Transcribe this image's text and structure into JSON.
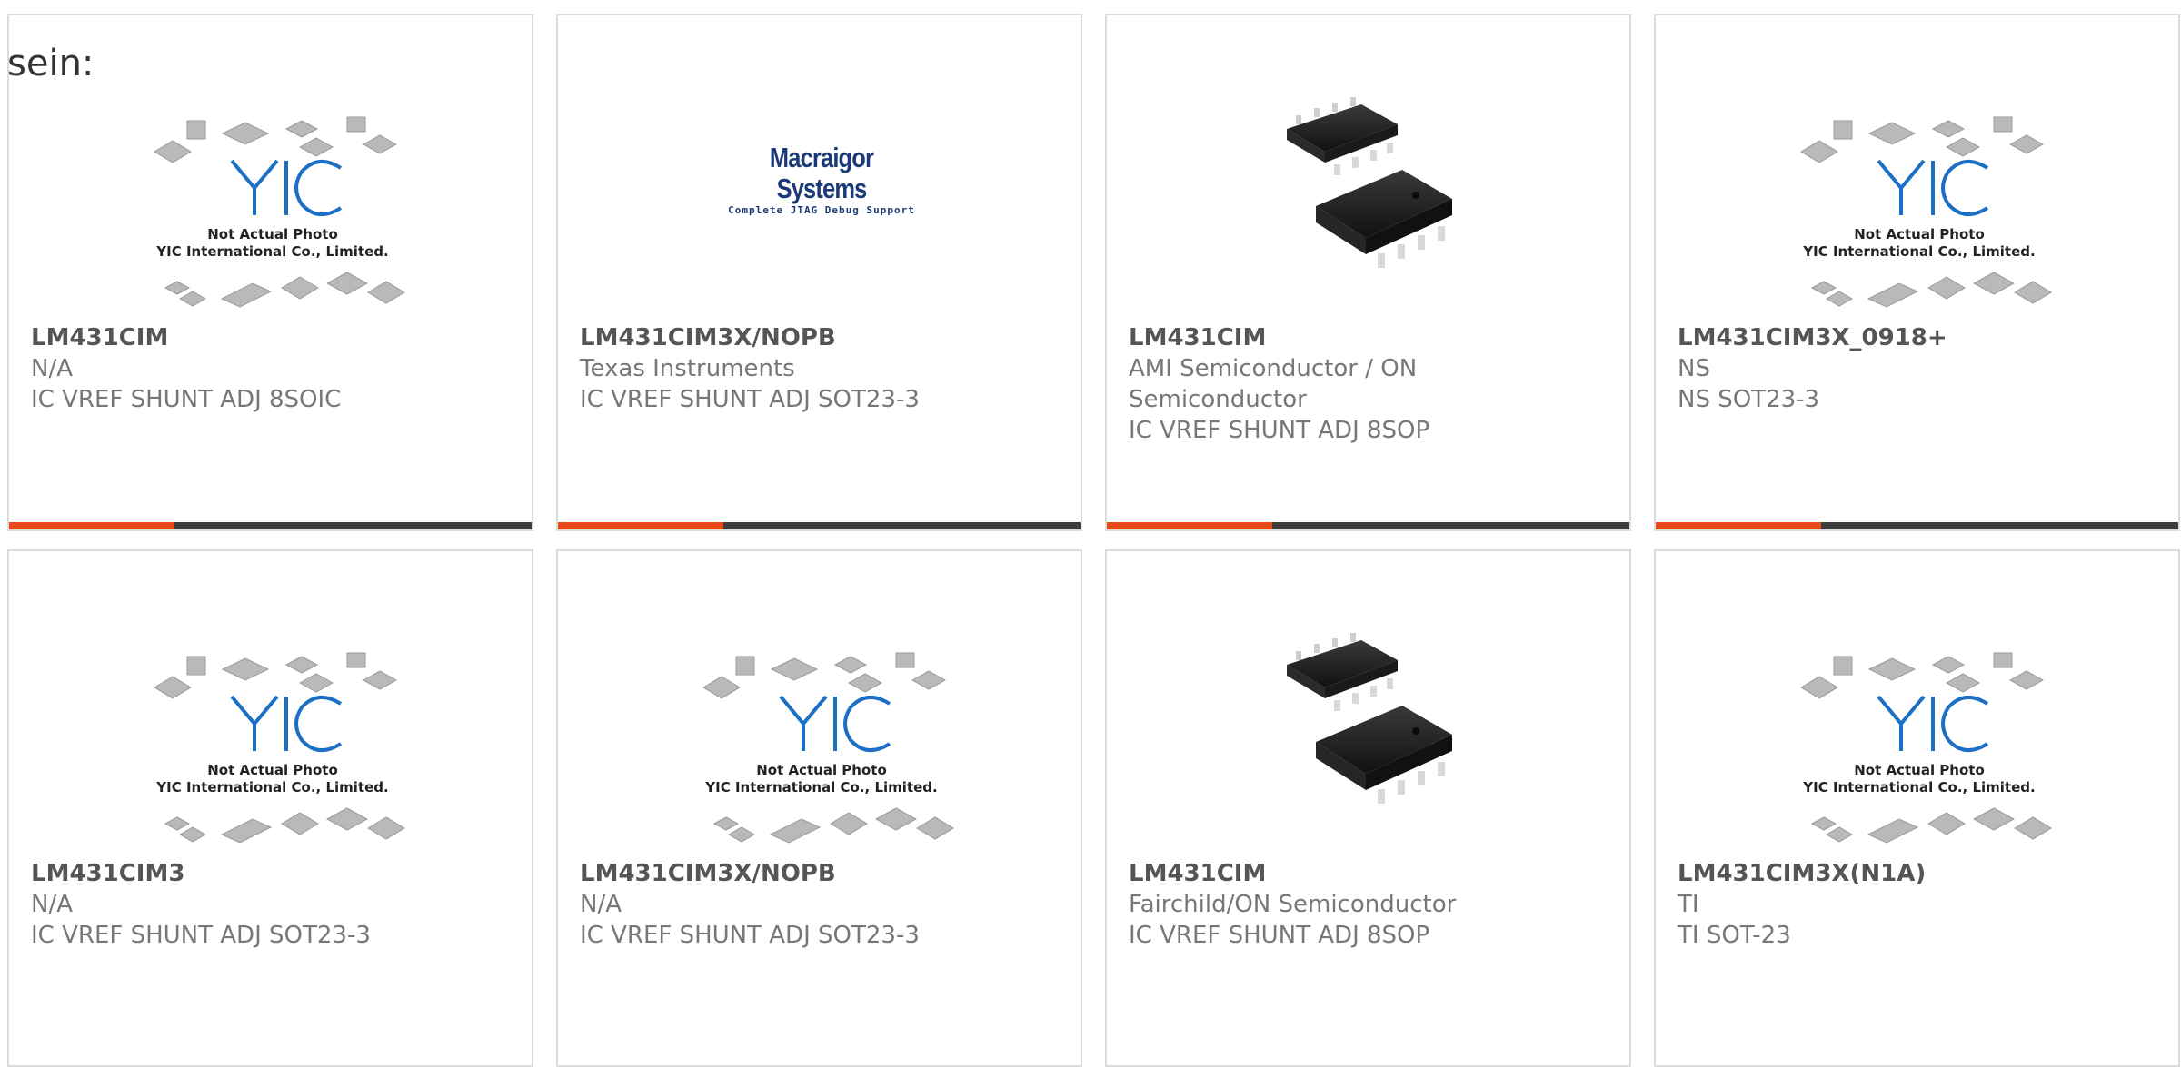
{
  "lead_text": "sein:",
  "placeholder": {
    "line1": "Not Actual Photo",
    "line2": "YIC International Co., Limited."
  },
  "macraigor": {
    "brand": "Macraigor Systems",
    "tagline": "Complete JTAG Debug Support"
  },
  "colors": {
    "accent": "#e84a1a",
    "bar": "#3c3c3c",
    "brand_blue": "#1b6fc4",
    "border": "#dcdcdc"
  },
  "cards": [
    {
      "image": "yic-placeholder",
      "part": "LM431CIM",
      "manufacturer": "N/A",
      "description": "IC VREF SHUNT ADJ 8SOIC"
    },
    {
      "image": "macraigor-logo",
      "part": "LM431CIM3X/NOPB",
      "manufacturer": "Texas Instruments",
      "description": "IC VREF SHUNT ADJ SOT23-3"
    },
    {
      "image": "soic8-photo",
      "part": "LM431CIM",
      "manufacturer": "AMI Semiconductor / ON Semiconductor",
      "description": "IC VREF SHUNT ADJ 8SOP"
    },
    {
      "image": "yic-placeholder",
      "part": "LM431CIM3X_0918+",
      "manufacturer": "NS",
      "description": "NS SOT23-3"
    },
    {
      "image": "yic-placeholder",
      "part": "LM431CIM3",
      "manufacturer": "N/A",
      "description": "IC VREF SHUNT ADJ SOT23-3"
    },
    {
      "image": "yic-placeholder",
      "part": "LM431CIM3X/NOPB",
      "manufacturer": "N/A",
      "description": "IC VREF SHUNT ADJ SOT23-3"
    },
    {
      "image": "soic8-photo",
      "part": "LM431CIM",
      "manufacturer": "Fairchild/ON Semiconductor",
      "description": "IC VREF SHUNT ADJ 8SOP"
    },
    {
      "image": "yic-placeholder",
      "part": "LM431CIM3X(N1A)",
      "manufacturer": "TI",
      "description": "TI SOT-23"
    }
  ]
}
